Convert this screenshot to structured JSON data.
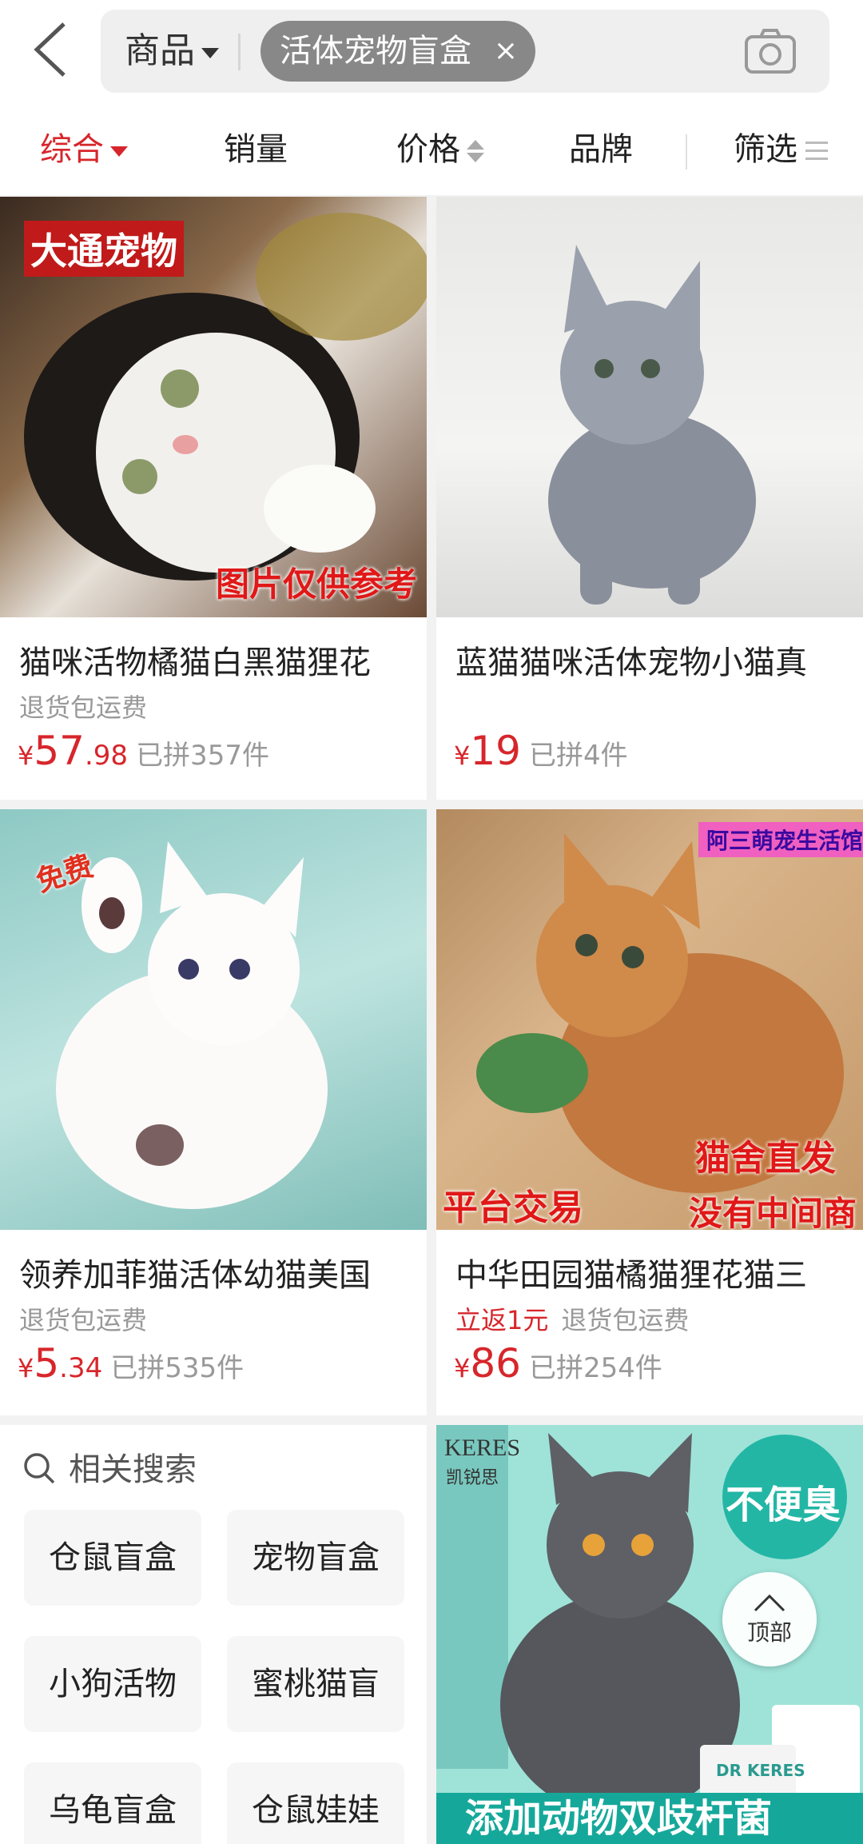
{
  "header": {
    "scope_label": "商品",
    "query_chip": "活体宠物盲盒",
    "chip_close": "×"
  },
  "sortbar": {
    "items": [
      "综合",
      "销量",
      "价格",
      "品牌",
      "筛选"
    ],
    "active_index": 0
  },
  "products": [
    {
      "title": "猫咪活物橘猫白黑猫狸花",
      "tags": [
        "退货包运费"
      ],
      "promo": "",
      "yen": "¥",
      "price_int": "57",
      "price_dec": ".98",
      "sold": "已拼357件",
      "overlays": [
        "大通宠物",
        "图片仅供参考"
      ]
    },
    {
      "title": "蓝猫猫咪活体宠物小猫真",
      "tags": [],
      "promo": "",
      "yen": "¥",
      "price_int": "19",
      "price_dec": "",
      "sold": "已拼4件",
      "overlays": []
    },
    {
      "title": "领养加菲猫活体幼猫美国",
      "tags": [
        "退货包运费"
      ],
      "promo": "",
      "yen": "¥",
      "price_int": "5",
      "price_dec": ".34",
      "sold": "已拼535件",
      "overlays": [
        "免费"
      ]
    },
    {
      "title": "中华田园猫橘猫狸花猫三",
      "tags": [
        "退货包运费"
      ],
      "promo": "立返1元",
      "yen": "¥",
      "price_int": "86",
      "price_dec": "",
      "sold": "已拼254件",
      "overlays": [
        "阿三萌宠生活馆",
        "猫舍直发",
        "平台交易",
        "没有中间商"
      ]
    }
  ],
  "related": {
    "heading": "相关搜索",
    "tags": [
      "仓鼠盲盒",
      "宠物盲盒",
      "小狗活物",
      "蜜桃猫盲",
      "乌龟盲盒",
      "仓鼠娃娃"
    ]
  },
  "ad": {
    "brand_en": "KERES",
    "brand_cn": "凯锐思",
    "badge": "不便臭",
    "banner": "添加动物双歧杆菌",
    "package_text": "DR KERES"
  },
  "back_to_top": "顶部",
  "colors": {
    "accent": "#d7262b",
    "muted": "#999999",
    "chip": "#888888"
  }
}
